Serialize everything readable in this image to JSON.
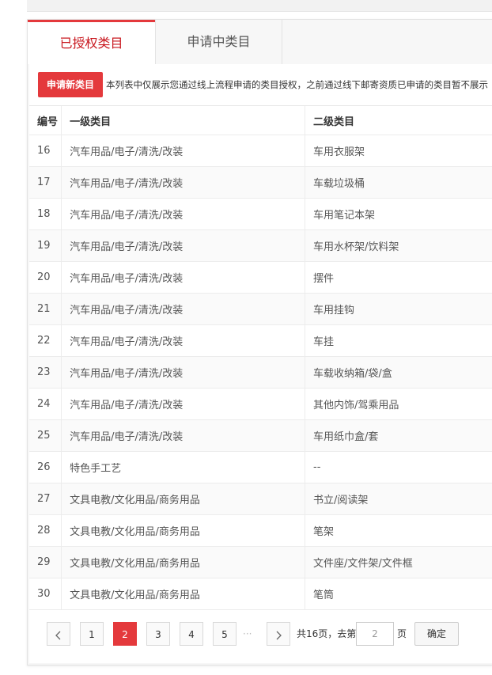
{
  "tabs": [
    {
      "label": "已授权类目"
    },
    {
      "label": "申请中类目"
    }
  ],
  "toolbar": {
    "apply_label": "申请新类目",
    "notice": "本列表中仅展示您通过线上流程申请的类目授权，之前通过线下邮寄资质已申请的类目暂不展示"
  },
  "table": {
    "headers": {
      "num": "编号",
      "level1": "一级类目",
      "level2": "二级类目"
    },
    "rows": [
      {
        "num": "16",
        "level1": "汽车用品/电子/清洗/改装",
        "level2": "车用衣服架"
      },
      {
        "num": "17",
        "level1": "汽车用品/电子/清洗/改装",
        "level2": "车载垃圾桶"
      },
      {
        "num": "18",
        "level1": "汽车用品/电子/清洗/改装",
        "level2": "车用笔记本架"
      },
      {
        "num": "19",
        "level1": "汽车用品/电子/清洗/改装",
        "level2": "车用水杯架/饮料架"
      },
      {
        "num": "20",
        "level1": "汽车用品/电子/清洗/改装",
        "level2": "摆件"
      },
      {
        "num": "21",
        "level1": "汽车用品/电子/清洗/改装",
        "level2": "车用挂钩"
      },
      {
        "num": "22",
        "level1": "汽车用品/电子/清洗/改装",
        "level2": "车挂"
      },
      {
        "num": "23",
        "level1": "汽车用品/电子/清洗/改装",
        "level2": "车载收纳箱/袋/盒"
      },
      {
        "num": "24",
        "level1": "汽车用品/电子/清洗/改装",
        "level2": "其他内饰/驾乘用品"
      },
      {
        "num": "25",
        "level1": "汽车用品/电子/清洗/改装",
        "level2": "车用纸巾盒/套"
      },
      {
        "num": "26",
        "level1": "特色手工艺",
        "level2": "--"
      },
      {
        "num": "27",
        "level1": "文具电教/文化用品/商务用品",
        "level2": "书立/阅读架"
      },
      {
        "num": "28",
        "level1": "文具电教/文化用品/商务用品",
        "level2": "笔架"
      },
      {
        "num": "29",
        "level1": "文具电教/文化用品/商务用品",
        "level2": "文件座/文件架/文件框"
      },
      {
        "num": "30",
        "level1": "文具电教/文化用品/商务用品",
        "level2": "笔筒"
      }
    ]
  },
  "pager": {
    "pages": [
      "1",
      "2",
      "3",
      "4",
      "5"
    ],
    "current": "2",
    "ellipsis": "···",
    "total_text": "共16页，去第",
    "input_value": "2",
    "page_suffix": "页",
    "confirm_label": "确定"
  },
  "colors": {
    "accent": "#e4393c",
    "tab_active_text": "#c8161d"
  }
}
